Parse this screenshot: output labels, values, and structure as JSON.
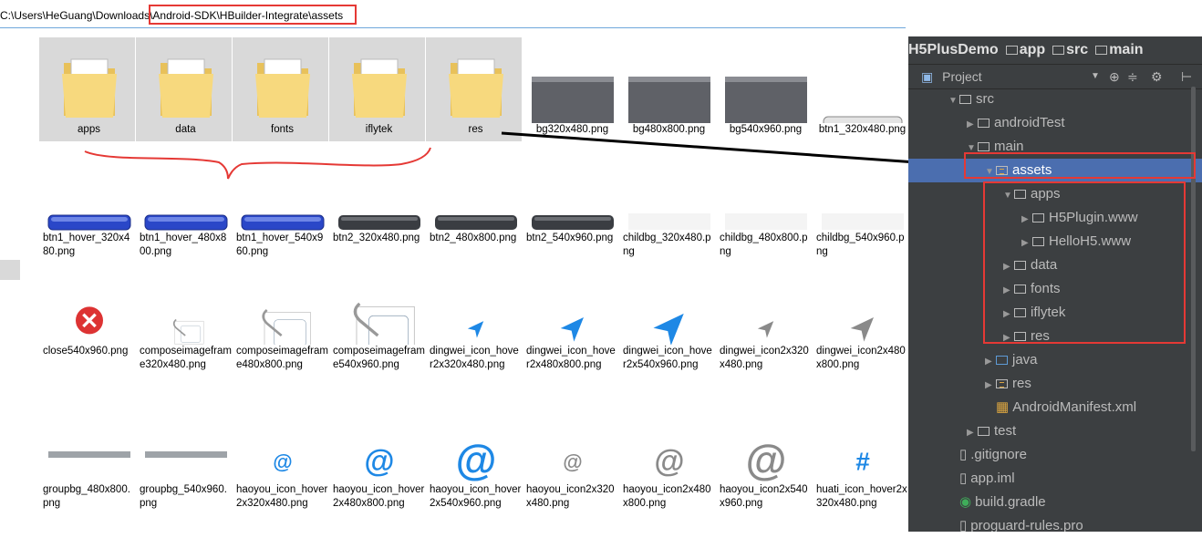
{
  "address": {
    "prefix": "C:\\Users\\HeGuang\\Downloads\\",
    "highlight": "Android-SDK\\HBuilder-Integrate\\assets"
  },
  "colors": {
    "annotation_red": "#e53935",
    "ide_bg": "#3c3f41",
    "ide_selection": "#4b6eaf",
    "folder_yellow": "#f5d77a"
  },
  "files": [
    {
      "label": "apps",
      "kind": "folder",
      "overlay": "doc-blue",
      "selected": true
    },
    {
      "label": "data",
      "kind": "folder",
      "overlay": "doc-globe",
      "selected": true
    },
    {
      "label": "fonts",
      "kind": "folder",
      "overlay": "font-abc",
      "selected": true
    },
    {
      "label": "iflytek",
      "kind": "folder",
      "overlay": "dark-page",
      "selected": true
    },
    {
      "label": "res",
      "kind": "folder",
      "overlay": "spinner",
      "selected": true
    },
    {
      "label": "bg320x480.png",
      "kind": "bg-dark"
    },
    {
      "label": "bg480x800.png",
      "kind": "bg-dark"
    },
    {
      "label": "bg540x960.png",
      "kind": "bg-dark"
    },
    {
      "label": "btn1_320x480.png",
      "kind": "btn-grey"
    },
    {
      "label": "btn1_hover_320x480.png",
      "kind": "btn-blue"
    },
    {
      "label": "btn1_hover_480x800.png",
      "kind": "btn-blue"
    },
    {
      "label": "btn1_hover_540x960.png",
      "kind": "btn-blue"
    },
    {
      "label": "btn2_320x480.png",
      "kind": "btn-dark"
    },
    {
      "label": "btn2_480x800.png",
      "kind": "btn-dark"
    },
    {
      "label": "btn2_540x960.png",
      "kind": "btn-dark"
    },
    {
      "label": "childbg_320x480.png",
      "kind": "blank"
    },
    {
      "label": "childbg_480x800.png",
      "kind": "blank"
    },
    {
      "label": "childbg_540x960.png",
      "kind": "blank"
    },
    {
      "label": "close540x960.png",
      "kind": "close"
    },
    {
      "label": "composeimageframe320x480.png",
      "kind": "clip-s"
    },
    {
      "label": "composeimageframe480x800.png",
      "kind": "clip-m"
    },
    {
      "label": "composeimageframe540x960.png",
      "kind": "clip-l"
    },
    {
      "label": "dingwei_icon_hover2x320x480.png",
      "kind": "loc-blue-s"
    },
    {
      "label": "dingwei_icon_hover2x480x800.png",
      "kind": "loc-blue-m"
    },
    {
      "label": "dingwei_icon_hover2x540x960.png",
      "kind": "loc-blue-l"
    },
    {
      "label": "dingwei_icon2x320x480.png",
      "kind": "loc-grey-s"
    },
    {
      "label": "dingwei_icon2x480x800.png",
      "kind": "loc-grey-m"
    },
    {
      "label": "groupbg_480x800.png",
      "kind": "line"
    },
    {
      "label": "groupbg_540x960.png",
      "kind": "line"
    },
    {
      "label": "haoyou_icon_hover2x320x480.png",
      "kind": "at-blue-s"
    },
    {
      "label": "haoyou_icon_hover2x480x800.png",
      "kind": "at-blue-m"
    },
    {
      "label": "haoyou_icon_hover2x540x960.png",
      "kind": "at-blue-l"
    },
    {
      "label": "haoyou_icon2x320x480.png",
      "kind": "at-grey-s"
    },
    {
      "label": "haoyou_icon2x480x800.png",
      "kind": "at-grey-m"
    },
    {
      "label": "haoyou_icon2x540x960.png",
      "kind": "at-grey-l"
    },
    {
      "label": "huati_icon_hover2x320x480.png",
      "kind": "hash"
    }
  ],
  "ide": {
    "breadcrumb": [
      "H5PlusDemo",
      "app",
      "src",
      "main"
    ],
    "panel_label": "Project",
    "tree": [
      {
        "label": "src",
        "depth": 0,
        "icon": "folder",
        "arrow": "open"
      },
      {
        "label": "androidTest",
        "depth": 1,
        "icon": "folder",
        "arrow": "closed"
      },
      {
        "label": "main",
        "depth": 1,
        "icon": "folder",
        "arrow": "open"
      },
      {
        "label": "assets",
        "depth": 2,
        "icon": "assets",
        "arrow": "open",
        "selected": true
      },
      {
        "label": "apps",
        "depth": 3,
        "icon": "folder",
        "arrow": "open"
      },
      {
        "label": "H5Plugin.www",
        "depth": 4,
        "icon": "folder",
        "arrow": "closed"
      },
      {
        "label": "HelloH5.www",
        "depth": 4,
        "icon": "folder",
        "arrow": "closed"
      },
      {
        "label": "data",
        "depth": 3,
        "icon": "folder",
        "arrow": "closed"
      },
      {
        "label": "fonts",
        "depth": 3,
        "icon": "folder",
        "arrow": "closed"
      },
      {
        "label": "iflytek",
        "depth": 3,
        "icon": "folder",
        "arrow": "closed"
      },
      {
        "label": "res",
        "depth": 3,
        "icon": "folder",
        "arrow": "closed"
      },
      {
        "label": "java",
        "depth": 2,
        "icon": "folder-blue",
        "arrow": "closed"
      },
      {
        "label": "res",
        "depth": 2,
        "icon": "assets",
        "arrow": "closed"
      },
      {
        "label": "AndroidManifest.xml",
        "depth": 2,
        "icon": "xml",
        "arrow": ""
      },
      {
        "label": "test",
        "depth": 1,
        "icon": "folder",
        "arrow": "closed"
      },
      {
        "label": ".gitignore",
        "depth": 0,
        "icon": "file",
        "arrow": ""
      },
      {
        "label": "app.iml",
        "depth": 0,
        "icon": "file",
        "arrow": ""
      },
      {
        "label": "build.gradle",
        "depth": 0,
        "icon": "gradle",
        "arrow": ""
      },
      {
        "label": "proguard-rules.pro",
        "depth": 0,
        "icon": "file",
        "arrow": ""
      }
    ]
  }
}
